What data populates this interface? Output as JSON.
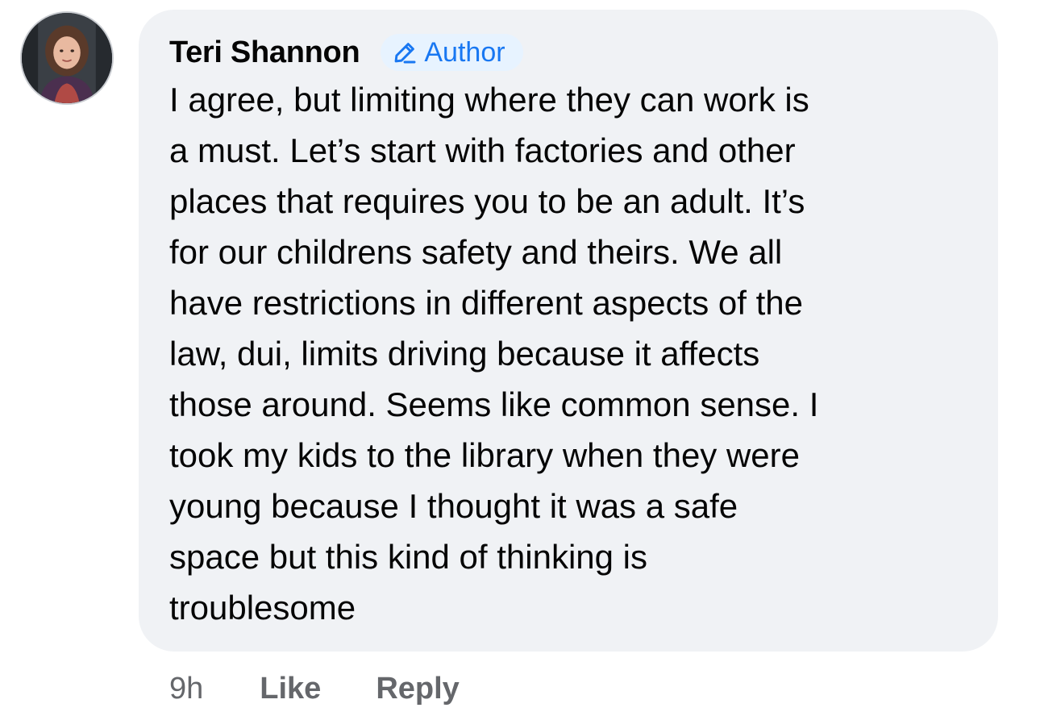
{
  "comment": {
    "author": "Teri Shannon",
    "badge_label": "Author",
    "badge_icon": "pencil-icon",
    "avatar_icon": "profile-photo",
    "text": "I agree, but limiting where they can work is\na must. Let’s start with factories and other\nplaces that requires you to be an adult. It’s\nfor our childrens safety and theirs. We all\nhave restrictions in different aspects of the\nlaw, dui, limits driving because it affects\nthose around. Seems like common sense. I\ntook my kids to the library when they were\nyoung because I thought it was a safe\nspace but this kind of thinking is\ntroublesome",
    "timestamp": "9h",
    "like_label": "Like",
    "reply_label": "Reply"
  },
  "colors": {
    "bubble_background": "#f0f2f5",
    "badge_background": "#e7f3ff",
    "badge_text": "#1877f2",
    "meta_text": "#65676b",
    "body_text": "#050505"
  }
}
